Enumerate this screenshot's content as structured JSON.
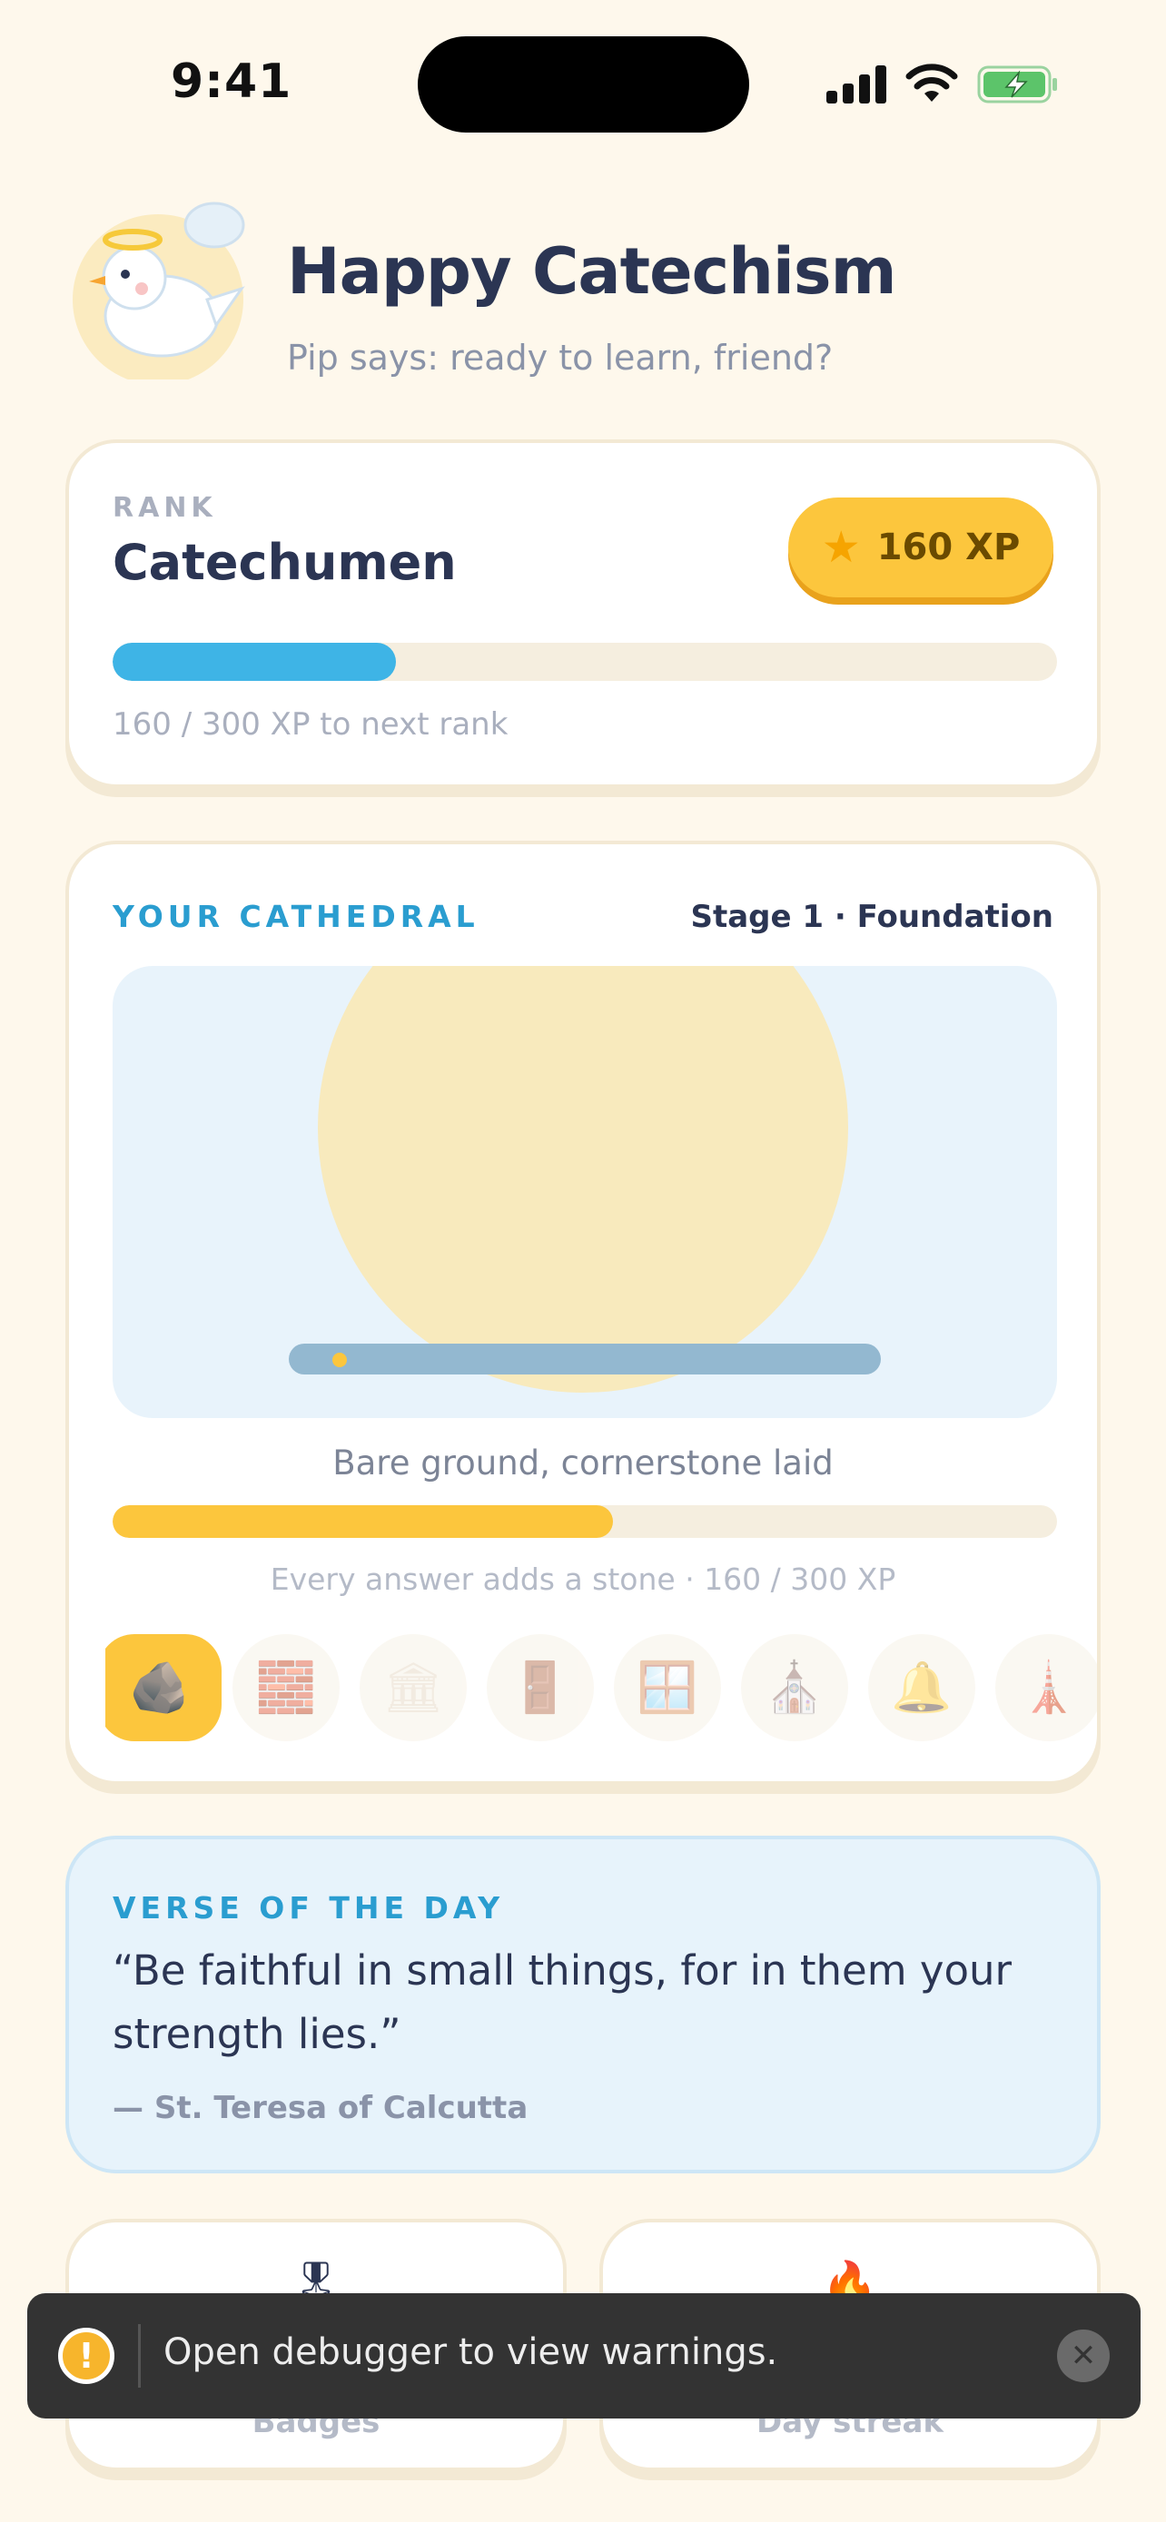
{
  "status_bar": {
    "time": "9:41"
  },
  "header": {
    "title": "Happy Catechism",
    "subtitle": "Pip says: ready to learn, friend?"
  },
  "rank": {
    "label": "RANK",
    "name": "Catechumen",
    "xp_badge": "160 XP",
    "progress_fraction": 0.3,
    "caption": "160 / 300 XP to next rank"
  },
  "cathedral": {
    "section_label": "YOUR CATHEDRAL",
    "stage_label": "Stage 1 · Foundation",
    "scene_caption": "Bare ground, cornerstone laid",
    "progress_fraction": 0.53,
    "progress_caption": "Every answer adds a stone · 160 / 300 XP",
    "stages": [
      {
        "icon": "rock-icon",
        "glyph": "🪨",
        "active": true
      },
      {
        "icon": "bricks-icon",
        "glyph": "🧱",
        "active": false
      },
      {
        "icon": "columns-icon",
        "glyph": "🏛",
        "active": false
      },
      {
        "icon": "door-icon",
        "glyph": "🚪",
        "active": false
      },
      {
        "icon": "window-icon",
        "glyph": "🪟",
        "active": false
      },
      {
        "icon": "church-icon",
        "glyph": "⛪",
        "active": false
      },
      {
        "icon": "bell-icon",
        "glyph": "🔔",
        "active": false
      },
      {
        "icon": "spire-icon",
        "glyph": "🗼",
        "active": false
      }
    ]
  },
  "verse": {
    "label": "VERSE OF THE DAY",
    "text": "“Be faithful in small things, for in them your strength lies.”",
    "source": "— St. Teresa of Calcutta"
  },
  "stats": {
    "badges_label": "Badges",
    "streak_label": "Day streak"
  },
  "toast": {
    "message": "Open debugger to view warnings."
  },
  "colors": {
    "background": "#FEF8EC",
    "accent_blue": "#3EB4E6",
    "accent_gold": "#FCC63D",
    "text_dark": "#2B3553"
  }
}
